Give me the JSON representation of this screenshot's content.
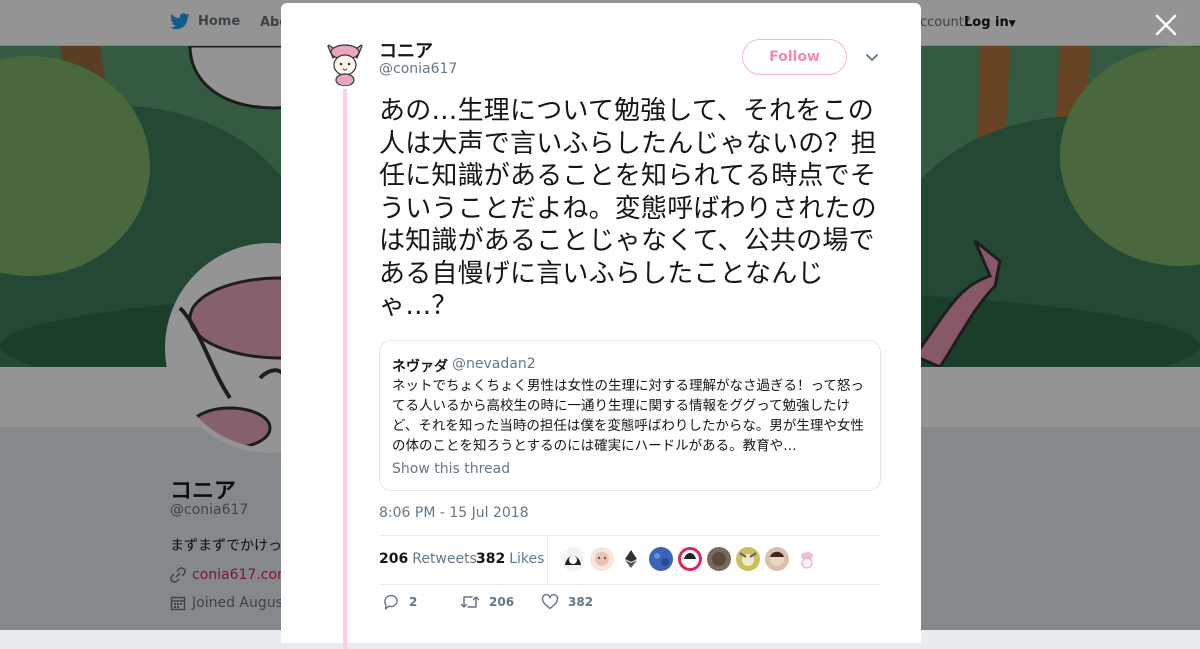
{
  "topnav": {
    "home_label": "Home",
    "about_label": "Abo",
    "account_text": "ccount?",
    "login_label": "Log in"
  },
  "profile": {
    "name": "コニア",
    "handle": "@conia617",
    "bio": "まずまずでかけっ",
    "link": "conia617.com",
    "joined": "Joined August"
  },
  "tweet": {
    "author_name": "コニア",
    "author_handle": "@conia617",
    "follow_label": "Follow",
    "text": "あの…生理について勉強して、それをこの人は大声で言いふらしたんじゃないの？担任に知識があることを知られてる時点でそういうことだよね。変態呼ばわりされたのは知識があることじゃなくて、公共の場である自慢げに言いふらしたことなんじゃ…？",
    "quote": {
      "name": "ネヴァダ",
      "handle": "@nevadan2",
      "text": "ネットでちょくちょく男性は女性の生理に対する理解がなさ過ぎる！って怒ってる人いるから高校生の時に一通り生理に関する情報をググって勉強したけど、それを知った当時の担任は僕を変態呼ばわりしたからな。男が生理や女性の体のことを知ろうとするのには確実にハードルがある。教育や…",
      "show_thread": "Show this thread"
    },
    "timestamp": "8:06 PM - 15 Jul 2018",
    "retweets_count": "206",
    "retweets_label": "Retweets",
    "likes_count": "382",
    "likes_label": "Likes",
    "reply_count": "2",
    "retweet_action_count": "206",
    "like_action_count": "382"
  },
  "colors": {
    "accent_pink": "#f08cab",
    "thread_line": "#ffd0dc",
    "twitter_blue": "#1da1f2",
    "link_pink": "#e0245e"
  }
}
